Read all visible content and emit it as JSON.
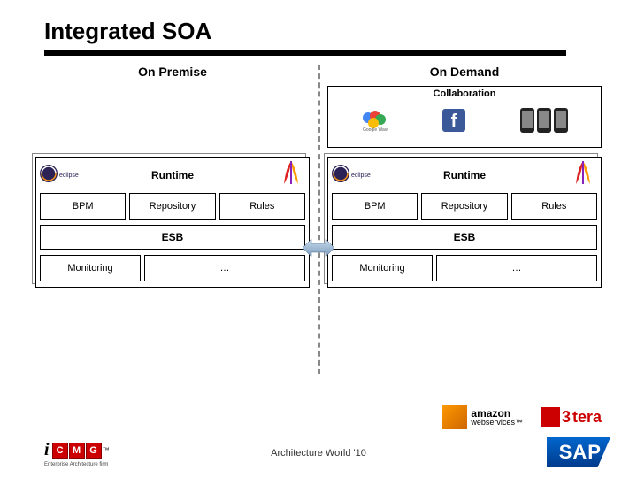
{
  "title": "Integrated SOA",
  "left": {
    "header": "On Premise",
    "runtime": "Runtime",
    "cells": {
      "bpm": "BPM",
      "repo": "Repository",
      "rules": "Rules"
    },
    "esb": "ESB",
    "bottom": {
      "monitoring": "Monitoring",
      "more": "…"
    }
  },
  "right": {
    "header": "On Demand",
    "collab": "Collaboration",
    "runtime": "Runtime",
    "cells": {
      "bpm": "BPM",
      "repo": "Repository",
      "rules": "Rules"
    },
    "esb": "ESB",
    "bottom": {
      "monitoring": "Monitoring",
      "more": "…"
    }
  },
  "footer": {
    "center": "Architecture World '10",
    "icmg_sub": "Enterprise Architecture firm",
    "sap": "SAP"
  },
  "logos": {
    "eclipse": "eclipse",
    "aws1": "amazon",
    "aws2": "webservices",
    "tera": "tera",
    "tera_num": "3",
    "gwave": "Google Wave"
  }
}
